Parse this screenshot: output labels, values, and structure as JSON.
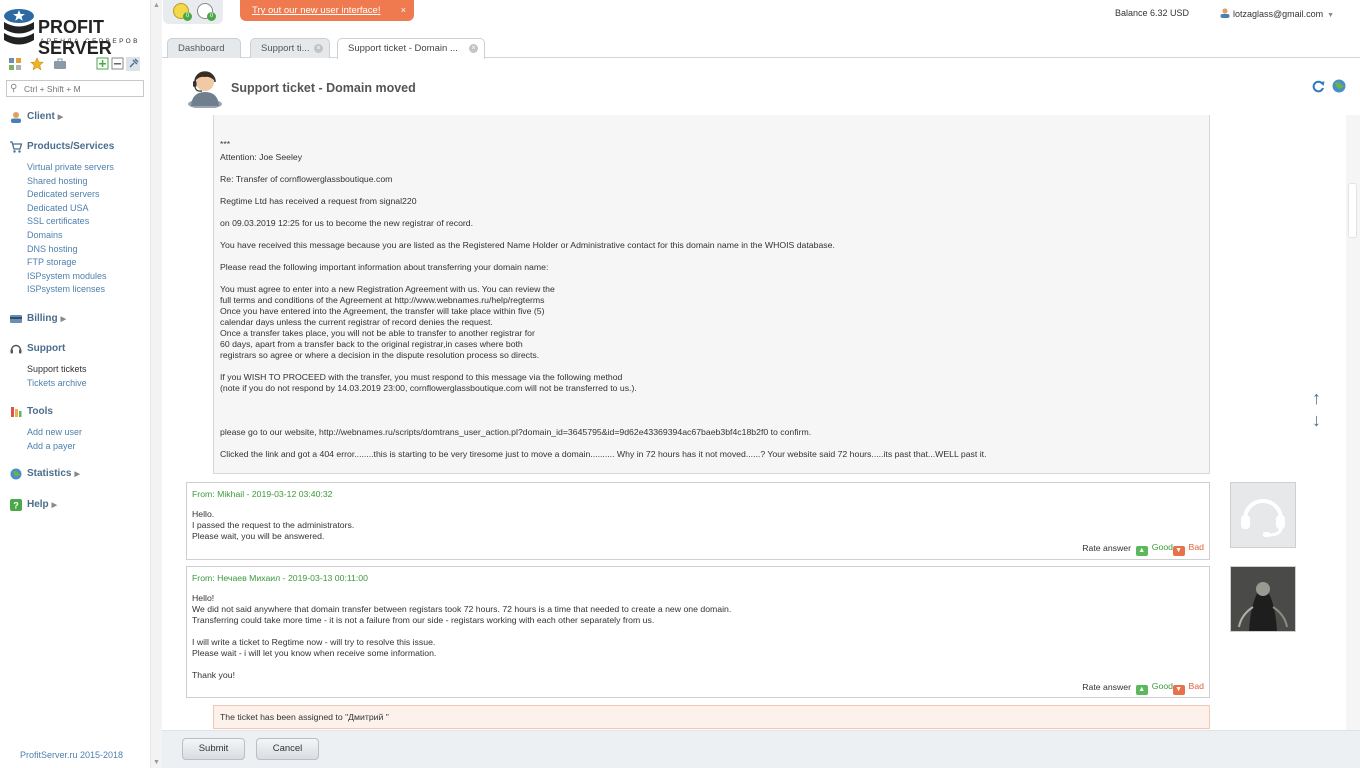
{
  "brand": {
    "name": "PROFIT SERVER",
    "tagline": "АРЕНДА СЕРВЕРОВ"
  },
  "sidebar": {
    "search_placeholder": "Ctrl + Shift + M",
    "groups": [
      {
        "title": "Client",
        "icon": "client-icon",
        "items": []
      },
      {
        "title": "Products/Services",
        "icon": "cart-icon",
        "items": [
          "Virtual private servers",
          "Shared hosting",
          "Dedicated servers",
          "Dedicated USA",
          "SSL certificates",
          "Domains",
          "DNS hosting",
          "FTP storage",
          "ISPsystem modules",
          "ISPsystem licenses"
        ]
      },
      {
        "title": "Billing",
        "icon": "billing-icon",
        "items": []
      },
      {
        "title": "Support",
        "icon": "headset-icon",
        "items": [
          "Support tickets",
          "Tickets archive"
        ]
      },
      {
        "title": "Tools",
        "icon": "tools-icon",
        "items": [
          "Add new user",
          "Add a payer"
        ]
      },
      {
        "title": "Statistics",
        "icon": "globe-icon",
        "items": []
      },
      {
        "title": "Help",
        "icon": "help-icon",
        "items": []
      }
    ],
    "footer": "ProfitServer.ru 2015-2018"
  },
  "topbar": {
    "promo_link": "Try out our new user interface!",
    "promo_close": "×",
    "balance": "Balance 6.32 USD",
    "user": "lotzaglass@gmail.com"
  },
  "tabs": [
    {
      "label": "Dashboard"
    },
    {
      "label": "Support ti..."
    },
    {
      "label": "Support ticket - Domain ..."
    }
  ],
  "page": {
    "title": "Support ticket - Domain moved"
  },
  "client_message": {
    "lines": [
      "***",
      "Attention: Joe Seeley",
      "Re: Transfer of cornflowerglassboutique.com",
      "Regtime Ltd has received a request from signal220",
      "on 09.03.2019 12:25 for us to become the new registrar of record.",
      "You have received this message because you are listed as the Registered Name Holder or Administrative contact for this domain name in the WHOIS database.",
      "Please read the following important information about transferring your domain name:",
      "You must agree to enter into a new Registration Agreement with us. You can review the",
      "full terms and conditions of the Agreement at http://www.webnames.ru/help/regterms",
      "Once you have entered into the Agreement, the transfer will take place within five (5)",
      "calendar days unless the current registrar of record denies the request.",
      "Once a transfer takes place, you will not be able to transfer to another registrar for",
      "60 days, apart from a transfer back to the original registrar,in cases where both",
      "registrars so agree or where a decision in the dispute resolution process so directs.",
      "If you WISH TO PROCEED with the transfer, you must respond to this message via the following method",
      "(note if you do not respond by 14.03.2019 23:00, cornflowerglassboutique.com will not be transferred to us.).",
      "please go to our website, http://webnames.ru/scripts/domtrans_user_action.pl?domain_id=3645795&id=9d62e43369394ac67baeb3bf4c18b2f0 to confirm.",
      "Clicked the link and got a 404 error........this is starting to be very tiresome just to move a domain.......... Why in 72 hours has it not moved......? Your website said 72 hours.....its past that...WELL past it."
    ]
  },
  "replies": [
    {
      "from": "From: Mikhail - 2019-03-12 03:40:32",
      "lines": [
        "Hello.",
        "I passed the request to the administrators.",
        "Please wait, you will be answered."
      ],
      "rate_label": "Rate answer",
      "good": "Good",
      "bad": "Bad"
    },
    {
      "from": "From: Нечаев Михаил - 2019-03-13 00:11:00",
      "lines": [
        "Hello!",
        "We did not said anywhere that domain transfer between registars took 72 hours. 72 hours is a time that needed to create a new one domain.",
        "Transferring could take more time - it is not a failure from our side - registars working with each other separately from us.",
        "I will write a ticket to Regtime now - will try to resolve this issue.",
        "Please wait - i will let you know when receive some information.",
        "Thank you!"
      ],
      "rate_label": "Rate answer",
      "good": "Good",
      "bad": "Bad"
    }
  ],
  "assigned": "The ticket has been assigned to \"Дмитрий \"",
  "buttons": {
    "submit": "Submit",
    "cancel": "Cancel"
  },
  "colors": {
    "link": "#4e7fad",
    "good": "#3b9a3b",
    "bad": "#e0603a",
    "promo": "#f07a4f"
  }
}
